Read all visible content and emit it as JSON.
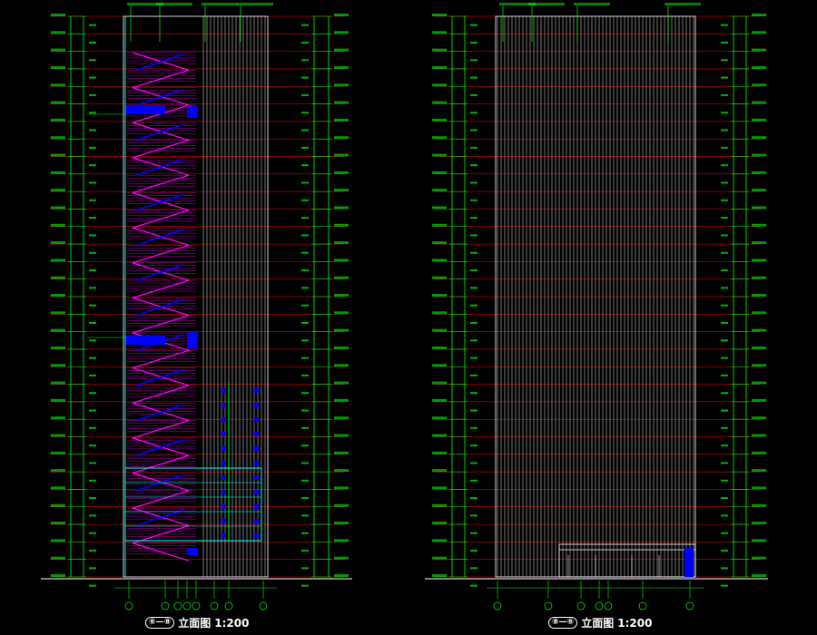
{
  "drawings": [
    {
      "id": "left",
      "title": {
        "axes_label": "⑥—⑧",
        "name": "立面图",
        "scale": "1:200"
      },
      "floors": 32,
      "features": [
        "stair-zigzag",
        "blue-openings",
        "cyan-glazing-grid"
      ]
    },
    {
      "id": "right",
      "title": {
        "axes_label": "⑧—⑥",
        "name": "立面图",
        "scale": "1:200"
      },
      "floors": 32,
      "features": [
        "entrance-canopy"
      ]
    }
  ],
  "colors": {
    "background": "#000000",
    "line": "#ffffff",
    "dimension": "#00ff00",
    "floor_line": "#ff0000",
    "stair": "#ff00ff",
    "opening": "#0000ff",
    "glazing": "#00ffff"
  }
}
